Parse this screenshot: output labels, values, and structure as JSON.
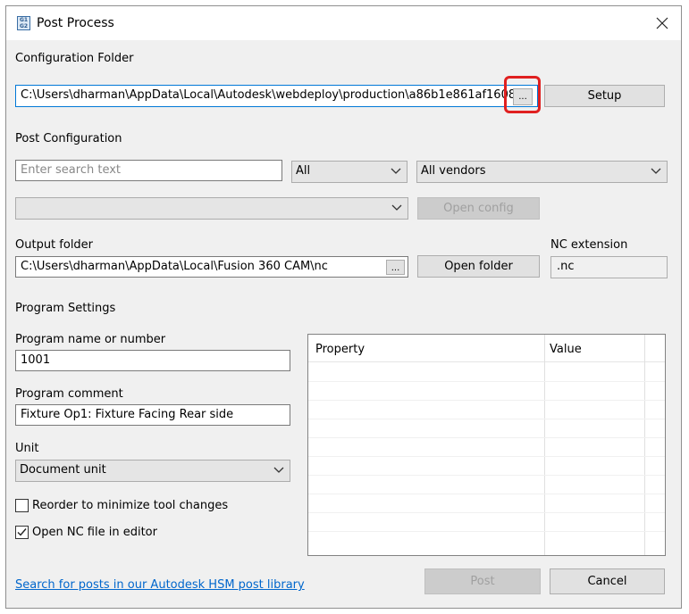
{
  "window": {
    "title": "Post Process",
    "icon_text": "G1 G2"
  },
  "config_folder": {
    "label": "Configuration Folder",
    "path": "C:\\Users\\dharman\\AppData\\Local\\Autodesk\\webdeploy\\production\\a86b1e861af1608",
    "browse_label": "...",
    "setup_label": "Setup"
  },
  "post_config": {
    "label": "Post Configuration",
    "search_placeholder": "Enter search text",
    "filter_value": "All",
    "vendor_value": "All vendors",
    "config_value": "",
    "open_config_label": "Open config"
  },
  "output": {
    "label": "Output folder",
    "path": "C:\\Users\\dharman\\AppData\\Local\\Fusion 360 CAM\\nc",
    "browse_label": "...",
    "open_folder_label": "Open folder",
    "nc_ext_label": "NC extension",
    "nc_ext_value": ".nc"
  },
  "program": {
    "section_label": "Program Settings",
    "name_label": "Program name or number",
    "name_value": "1001",
    "comment_label": "Program comment",
    "comment_value": "Fixture Op1: Fixture Facing  Rear side",
    "unit_label": "Unit",
    "unit_value": "Document unit",
    "reorder_label": "Reorder to minimize tool changes",
    "reorder_checked": false,
    "open_nc_label": "Open NC file in editor",
    "open_nc_checked": true
  },
  "properties": {
    "col_property": "Property",
    "col_value": "Value"
  },
  "footer": {
    "library_link": "Search for posts in our Autodesk HSM post library",
    "post_label": "Post",
    "cancel_label": "Cancel"
  },
  "colors": {
    "accent": "#0078d7",
    "highlight": "#e02020",
    "link": "#0066cc"
  },
  "icons": [
    "app-icon",
    "close-icon",
    "chevron-down-icon",
    "checkmark-icon"
  ]
}
